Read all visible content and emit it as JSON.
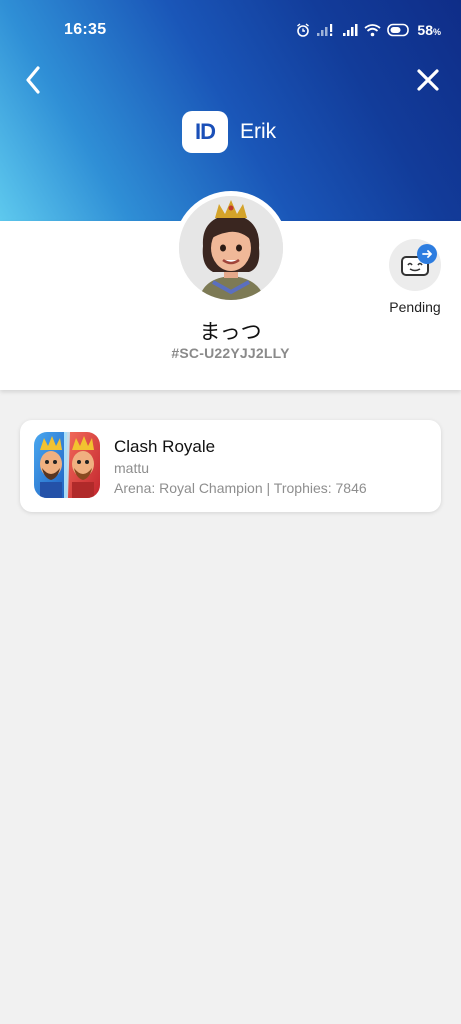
{
  "status_bar": {
    "time": "16:35",
    "battery_percent": "58",
    "battery_unit": "%",
    "icons": [
      "alarm-icon",
      "signal-icon",
      "signal-icon",
      "wifi-icon",
      "battery-icon"
    ]
  },
  "header": {
    "back_icon": "chevron-left-icon",
    "close_icon": "close-icon",
    "brand_badge": "ID",
    "brand_name": "Erik",
    "gradient_colors": [
      "#5ec9ee",
      "#2f8fd6",
      "#1a56b8",
      "#0f2d88"
    ]
  },
  "profile": {
    "display_name": "まっつ",
    "supercell_id": "#SC-U22YJJ2LLY",
    "avatar_icon": "princess-avatar-icon",
    "pending_label": "Pending",
    "pending_icon": "friend-request-icon"
  },
  "games": [
    {
      "title": "Clash Royale",
      "player_name": "mattu",
      "stats": "Arena: Royal Champion | Trophies: 7846",
      "icon": "clash-royale-icon"
    }
  ]
}
